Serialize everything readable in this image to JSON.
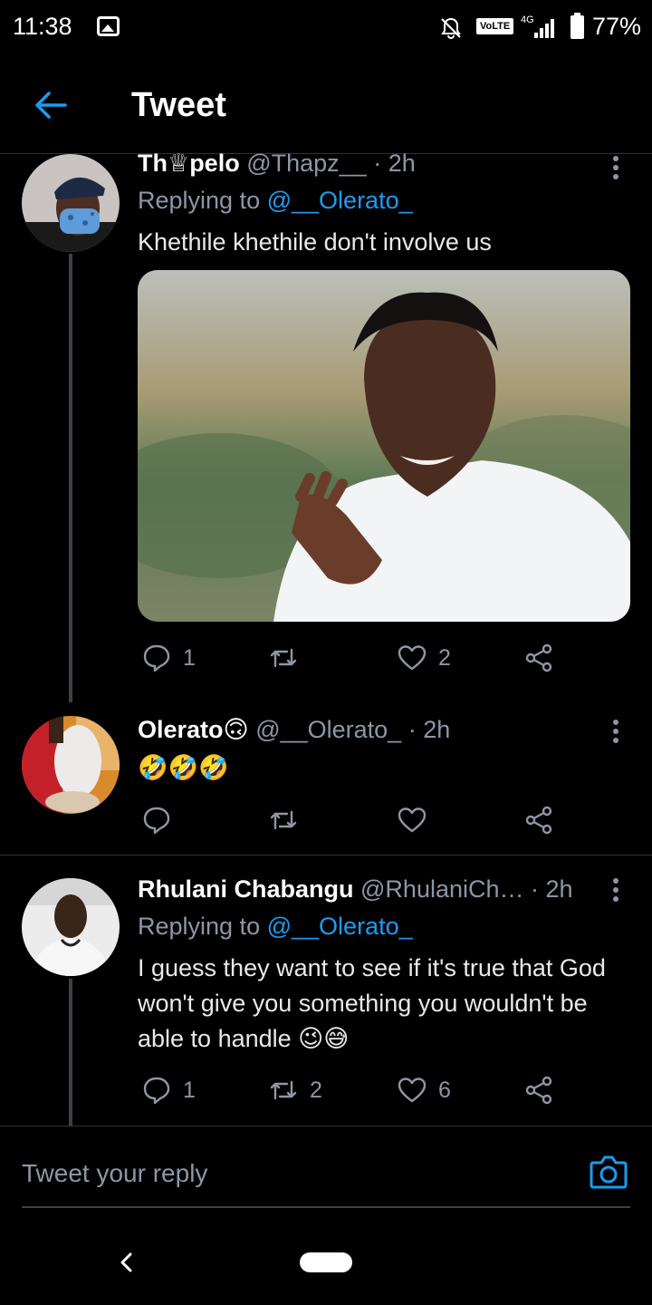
{
  "status_bar": {
    "time": "11:38",
    "network_badge": "VoLTE",
    "network_type": "4G",
    "battery": "77%",
    "icons": [
      "gallery-icon",
      "mute-icon",
      "signal-icon",
      "battery-icon"
    ]
  },
  "header": {
    "title": "Tweet",
    "back_icon": "arrow-left-icon"
  },
  "tweets": [
    {
      "name": "Th♕pelo",
      "handle": "@Thapz__",
      "time": "· 2h",
      "replying_prefix": "Replying to",
      "replying_to": "@__Olerato_",
      "text": "Khethile khethile don't involve us",
      "has_media": true,
      "stats": {
        "replies": "1",
        "retweets": "",
        "likes": "2"
      }
    },
    {
      "name": "Olerato🙃",
      "handle": "@__Olerato_",
      "time": "· 2h",
      "text": "🤣🤣🤣",
      "stats": {
        "replies": "",
        "retweets": "",
        "likes": ""
      }
    },
    {
      "name": "Rhulani Chabangu",
      "handle": "@RhulaniCh…",
      "time": "· 2h",
      "replying_prefix": "Replying to",
      "replying_to": "@__Olerato_",
      "text": "I guess they want to see if it's true that God won't give you something you wouldn't be able to handle 😉😅",
      "stats": {
        "replies": "1",
        "retweets": "2",
        "likes": "6"
      }
    }
  ],
  "composer": {
    "placeholder": "Tweet your reply"
  },
  "colors": {
    "background": "#000000",
    "accent": "#1d9bf0",
    "secondary_text": "#8b98a5",
    "divider": "#2f3336"
  }
}
